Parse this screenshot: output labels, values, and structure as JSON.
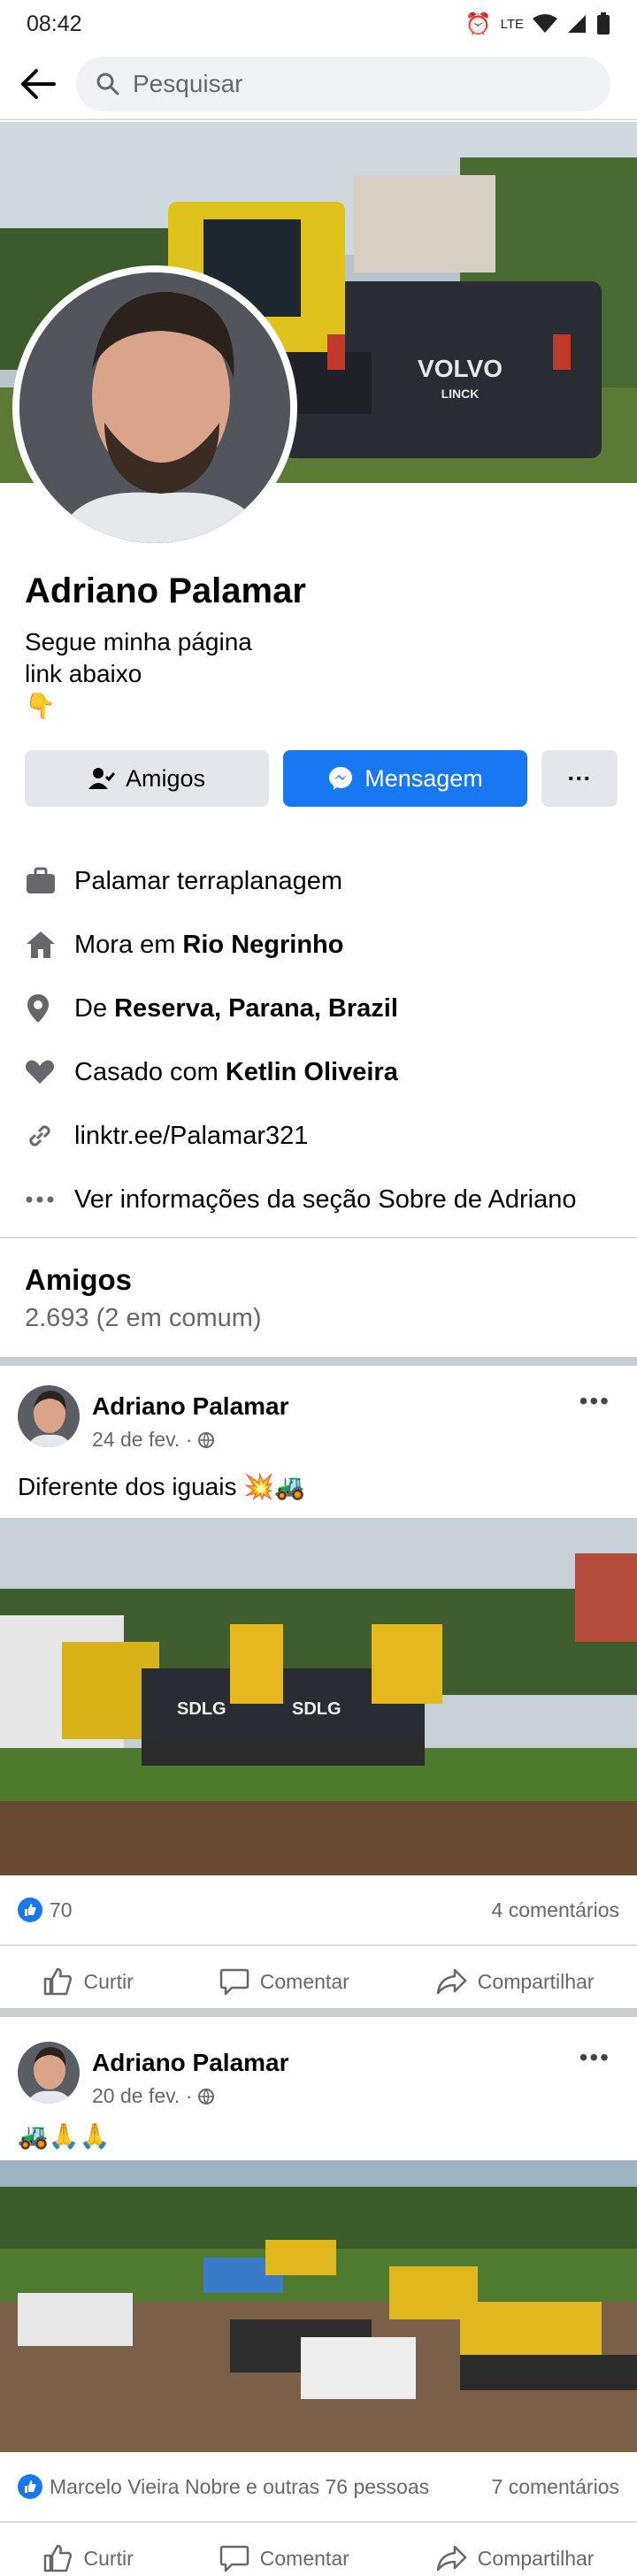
{
  "status_bar": {
    "time": "08:42",
    "network": "LTE"
  },
  "search": {
    "placeholder": "Pesquisar"
  },
  "profile": {
    "name": "Adriano Palamar",
    "bio_line1": "Segue minha página",
    "bio_line2": "link abaixo",
    "bio_emoji": "👇",
    "cover_text": "VOLVO",
    "cover_text2": "LINCK"
  },
  "buttons": {
    "friends": "Amigos",
    "message": "Mensagem",
    "more": "···"
  },
  "info": {
    "work": "Palamar terraplanagem",
    "lives_prefix": "Mora em",
    "lives_city": "Rio Negrinho",
    "from_prefix": "De",
    "from_place": "Reserva, Parana, Brazil",
    "married_prefix": "Casado com",
    "married_to": "Ketlin Oliveira",
    "link": "linktr.ee/Palamar321",
    "about": "Ver informações da seção Sobre de Adriano"
  },
  "friends": {
    "title": "Amigos",
    "count": "2.693 (2 em comum)"
  },
  "posts": [
    {
      "author": "Adriano Palamar",
      "date": "24 de fev. ·",
      "text": "Diferente dos iguais 💥🚜",
      "likes": "70",
      "comments": "4 comentários",
      "image_text": "SDLG"
    },
    {
      "author": "Adriano Palamar",
      "date": "20 de fev. ·",
      "text": "🚜🙏🙏",
      "likes": "Marcelo Vieira Nobre e outras 76 pessoas",
      "comments": "7 comentários"
    }
  ],
  "post_actions": {
    "like": "Curtir",
    "comment": "Comentar",
    "share": "Compartilhar"
  },
  "colors": {
    "accent": "#1877f2",
    "secondary_text": "#65676b",
    "button_gray": "#e4e6eb"
  }
}
